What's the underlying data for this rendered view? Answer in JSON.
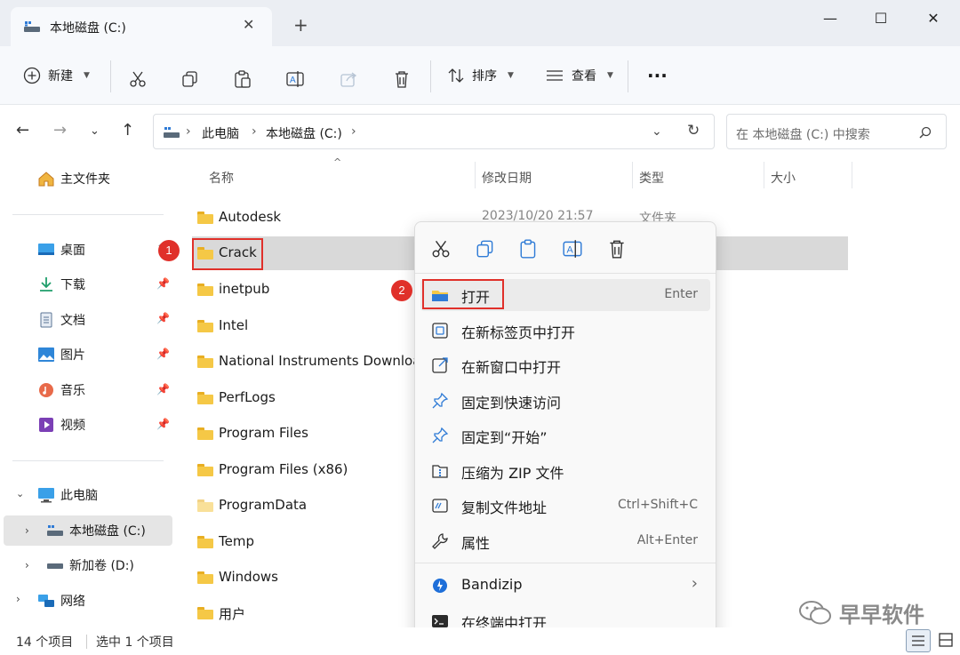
{
  "window": {
    "tab_title": "本地磁盘 (C:)",
    "tab_close": "✕",
    "new_tab": "+",
    "minimize": "—",
    "maximize": "☐",
    "close": "✕"
  },
  "toolbar": {
    "new_label": "新建",
    "sort_label": "排序",
    "view_label": "查看",
    "more": "···"
  },
  "address": {
    "crumbs": [
      "此电脑",
      "本地磁盘 (C:)"
    ],
    "search_placeholder": "在 本地磁盘 (C:) 中搜索"
  },
  "sidebar": {
    "home": "主文件夹",
    "quick": [
      {
        "label": "桌面",
        "icon": "desktop-icon"
      },
      {
        "label": "下载",
        "icon": "download-icon"
      },
      {
        "label": "文档",
        "icon": "document-icon"
      },
      {
        "label": "图片",
        "icon": "picture-icon"
      },
      {
        "label": "音乐",
        "icon": "music-icon"
      },
      {
        "label": "视频",
        "icon": "video-icon"
      }
    ],
    "this_pc": "此电脑",
    "drive_c": "本地磁盘 (C:)",
    "drive_d": "新加卷 (D:)",
    "network": "网络"
  },
  "columns": {
    "name": "名称",
    "date": "修改日期",
    "type": "类型",
    "size": "大小"
  },
  "files": [
    {
      "name": "Autodesk",
      "date": "2023/10/20 21:57",
      "type": "文件夹"
    },
    {
      "name": "Crack",
      "date": "",
      "type": ""
    },
    {
      "name": "inetpub",
      "date": "",
      "type": ""
    },
    {
      "name": "Intel",
      "date": "",
      "type": ""
    },
    {
      "name": "National Instruments Downloads",
      "date": "",
      "type": ""
    },
    {
      "name": "PerfLogs",
      "date": "",
      "type": ""
    },
    {
      "name": "Program Files",
      "date": "",
      "type": ""
    },
    {
      "name": "Program Files (x86)",
      "date": "",
      "type": ""
    },
    {
      "name": "ProgramData",
      "date": "",
      "type": ""
    },
    {
      "name": "Temp",
      "date": "",
      "type": ""
    },
    {
      "name": "Windows",
      "date": "",
      "type": ""
    },
    {
      "name": "用户",
      "date": "",
      "type": ""
    }
  ],
  "context_menu": {
    "items": [
      {
        "label": "打开",
        "shortcut": "Enter"
      },
      {
        "label": "在新标签页中打开",
        "shortcut": ""
      },
      {
        "label": "在新窗口中打开",
        "shortcut": ""
      },
      {
        "label": "固定到快速访问",
        "shortcut": ""
      },
      {
        "label": "固定到“开始”",
        "shortcut": ""
      },
      {
        "label": "压缩为 ZIP 文件",
        "shortcut": ""
      },
      {
        "label": "复制文件地址",
        "shortcut": "Ctrl+Shift+C"
      },
      {
        "label": "属性",
        "shortcut": "Alt+Enter"
      },
      {
        "label": "Bandizip",
        "shortcut": "›"
      },
      {
        "label": "在终端中打开",
        "shortcut": ""
      }
    ]
  },
  "badges": {
    "one": "1",
    "two": "2"
  },
  "status": {
    "count": "14 个项目",
    "selected": "选中 1 个项目"
  },
  "watermark": "早早软件",
  "colors": {
    "accent_red": "#e0302a",
    "folder_yellow": "#f5c846",
    "selection": "#d9d9d9"
  }
}
